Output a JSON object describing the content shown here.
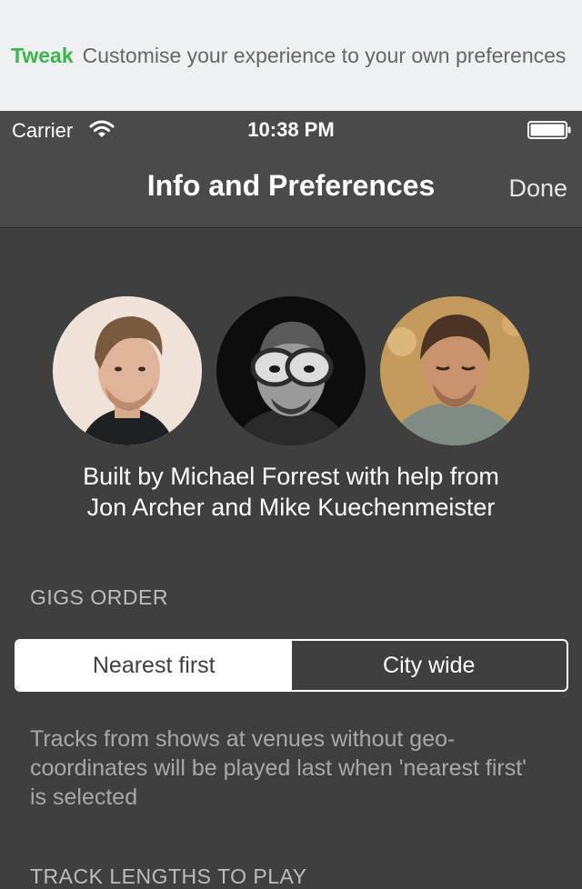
{
  "banner": {
    "brand": "Tweak",
    "tagline": "Customise your experience to your own preferences",
    "brand_color": "#3cb54a"
  },
  "statusbar": {
    "carrier": "Carrier",
    "time": "10:38 PM",
    "wifi_icon": "wifi-icon",
    "battery_icon": "battery-icon"
  },
  "navbar": {
    "title": "Info and Preferences",
    "done_label": "Done"
  },
  "credits": {
    "line1": "Built by Michael Forrest with help from",
    "line2": "Jon Archer and Mike Kuechenmeister"
  },
  "gigs_order": {
    "header": "GIGS ORDER",
    "options": [
      "Nearest first",
      "City wide"
    ],
    "selected": "Nearest first",
    "footnote": "Tracks from shows at venues without geo-coordinates will be played last when 'nearest first' is selected"
  },
  "next_section": {
    "header": "TRACK LENGTHS TO PLAY"
  }
}
